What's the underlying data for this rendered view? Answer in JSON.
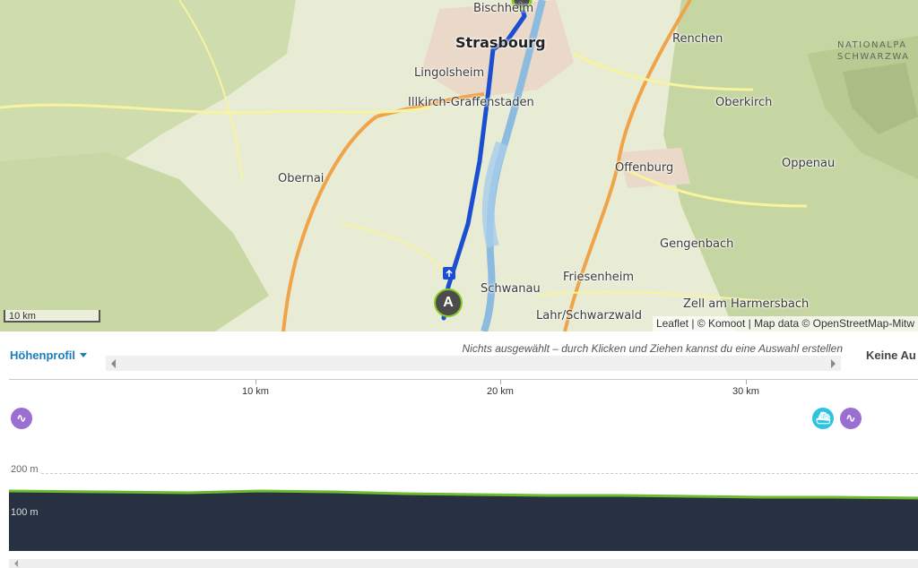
{
  "map": {
    "places": [
      {
        "id": "bischheim",
        "label": "Bischheim"
      },
      {
        "id": "strasbourg",
        "label": "Strasbourg"
      },
      {
        "id": "renchen",
        "label": "Renchen"
      },
      {
        "id": "lingolsheim",
        "label": "Lingolsheim"
      },
      {
        "id": "illkirch",
        "label": "Illkirch-Graffenstaden"
      },
      {
        "id": "oberkirch",
        "label": "Oberkirch"
      },
      {
        "id": "obernai",
        "label": "Obernai"
      },
      {
        "id": "offenburg",
        "label": "Offenburg"
      },
      {
        "id": "oppenau",
        "label": "Oppenau"
      },
      {
        "id": "gengenbach",
        "label": "Gengenbach"
      },
      {
        "id": "schwanau",
        "label": "Schwanau"
      },
      {
        "id": "friesenheim",
        "label": "Friesenheim"
      },
      {
        "id": "zell",
        "label": "Zell am Harmersbach"
      },
      {
        "id": "lahr",
        "label": "Lahr/Schwarzwald"
      }
    ],
    "park_label": [
      "NATIONALPA",
      "SCHWARZWA"
    ],
    "scale_label": "10 km",
    "attribution": "Leaflet | © Komoot | Map data © OpenStreetMap-Mitw",
    "start_marker": "A",
    "route_color": "#1b4fd1",
    "marker_ring_color": "#8ac926"
  },
  "profile": {
    "dropdown_label": "Höhenprofil",
    "hint": "Nichts ausgewählt – durch Klicken und Ziehen kannst du eine Auswahl erstellen",
    "right_label": "Keine Au",
    "km_labels": [
      "10 km",
      "20 km",
      "30 km"
    ],
    "y_labels": [
      "200 m",
      "100 m"
    ],
    "poi_icons": [
      "cycling-icon",
      "ferry-icon",
      "cycling-icon"
    ],
    "fill_color": "#273142",
    "line_color": "#6dbb2e"
  }
}
